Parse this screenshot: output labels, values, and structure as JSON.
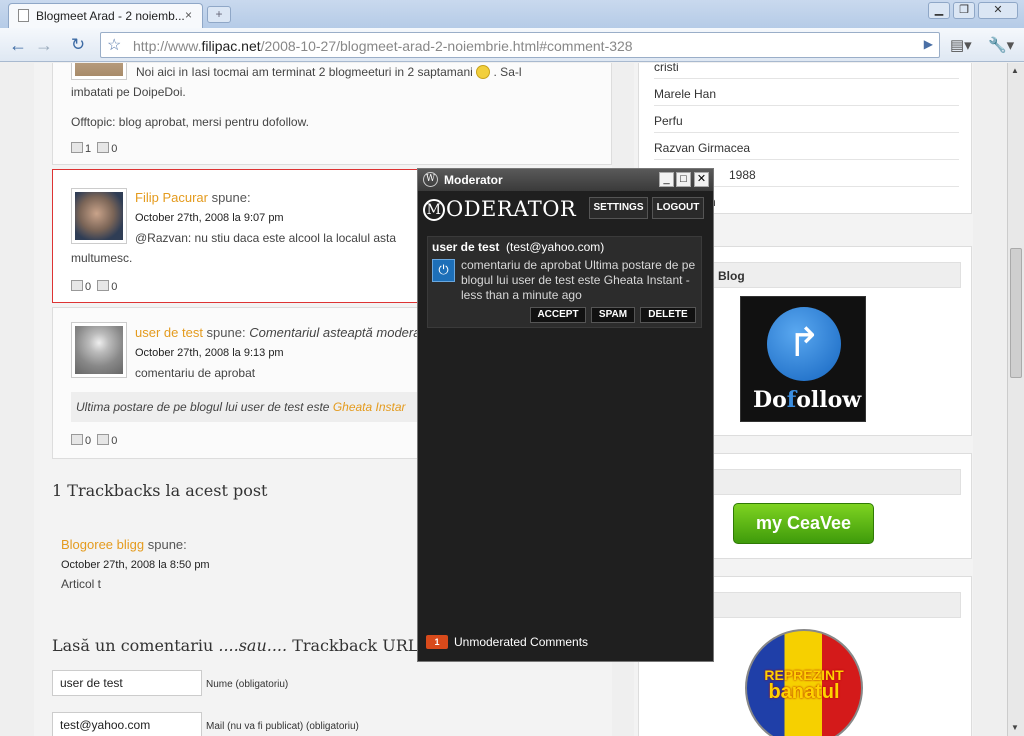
{
  "browser": {
    "tab_title": "Blogmeet Arad - 2 noiemb...",
    "tab_close": "×",
    "new_tab": "+",
    "url_prefix": "http://www.",
    "url_domain": "filipac.net",
    "url_path": "/2008-10-27/blogmeet-arad-2-noiembrie.html#comment-328",
    "win_minimize": "▁",
    "win_maximize": "❐",
    "win_close": "✕"
  },
  "comments": [
    {
      "line1": "Noi aici in Iasi tocmai am terminat 2 blogmeeturi in 2 saptamani",
      "line1b": ". Sa-l",
      "line2": "imbatati pe DoipeDoi.",
      "line3": "Offtopic: blog aprobat, mersi pentru dofollow.",
      "up": "1",
      "down": "0"
    },
    {
      "author": "Filip Pacurar",
      "spune": " spune:",
      "date": "October 27th, 2008 la 9:07 pm",
      "line1": "@Razvan: nu stiu daca este alcool la localul asta",
      "line2": "multumesc.",
      "up": "0",
      "down": "0"
    },
    {
      "author": "user de test",
      "spune": " spune: ",
      "status": "Comentariul asteaptă moderar",
      "date": "October 27th, 2008 la 9:13 pm",
      "line1": "comentariu de aprobat",
      "sig": "Ultima postare de pe blogul lui user de test este ",
      "sig_link": "Gheata Instar",
      "up": "0",
      "down": "0"
    }
  ],
  "trackbacks": {
    "heading": "1 Trackbacks la acest post",
    "author": "Blogoree bligg",
    "spune": " spune:",
    "date": "October 27th, 2008 la 8:50 pm",
    "text": "Articol t"
  },
  "form": {
    "heading_a": "Lasă un comentariu ",
    "heading_b": "....sau....",
    "heading_c": " Trackback URL",
    "name_value": "user de test",
    "name_label": "Nume (obligatoriu)",
    "mail_value": "test@yahoo.com",
    "mail_label": "Mail (nu va fi publicat) (obligatoriu)"
  },
  "sidebar": {
    "items": [
      "cristi",
      "Marele Han",
      "Perfu",
      "Razvan Girmacea",
      "1988",
      "n"
    ],
    "widget2_title": "Blog",
    "dofollow_a": "Do",
    "dofollow_b": "ollow",
    "cv_label": "my CeaVee",
    "banat_a": "REPREZINT",
    "banat_b": "banatul"
  },
  "moderator": {
    "window_title": "Moderator",
    "logo": "ODERATOR",
    "settings": "SETTINGS",
    "logout": "LOGOUT",
    "user": "user de test",
    "email": "(test@yahoo.com)",
    "message": "comentariu de aprobat Ultima postare de pe blogul lui user de test este Gheata Instant - less than a minute ago",
    "accept": "ACCEPT",
    "spam": "SPAM",
    "delete": "DELETE",
    "count": "1",
    "footer": "Unmoderated Comments"
  },
  "colors": {
    "link_orange": "#e49b1e",
    "highlight_red": "#dd3333",
    "moderator_bg": "#1f1f1f"
  }
}
